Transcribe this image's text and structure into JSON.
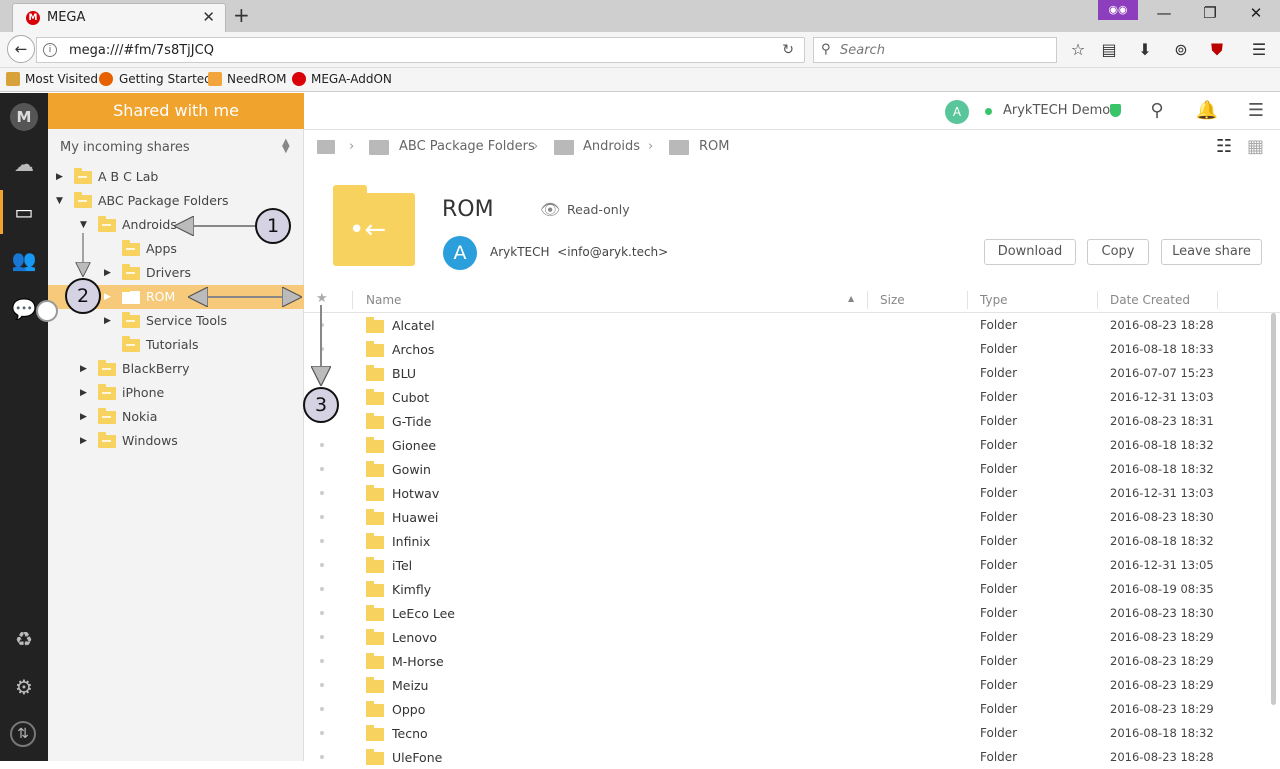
{
  "browser": {
    "tab_title": "MEGA",
    "favicon": "M",
    "url": "mega:///#fm/7s8TjJCQ",
    "search_placeholder": "Search",
    "bookmarks": [
      "Most Visited",
      "Getting Started",
      "NeedROM",
      "MEGA-AddON"
    ],
    "private_icon": "mask-icon"
  },
  "rail": {
    "items": [
      "mega-logo-icon",
      "cloud-drive-icon",
      "shared-folder-icon",
      "contacts-icon",
      "chat-icon",
      "rubbish-bin-icon",
      "settings-icon",
      "transfers-icon"
    ],
    "logo": "M"
  },
  "tree": {
    "header": "Shared with me",
    "incoming_label": "My incoming shares",
    "nodes": [
      {
        "label": "A B C Lab"
      },
      {
        "label": "ABC Package Folders"
      },
      {
        "label": "Androids"
      },
      {
        "label": "Apps"
      },
      {
        "label": "Drivers"
      },
      {
        "label": "ROM"
      },
      {
        "label": "Service Tools"
      },
      {
        "label": "Tutorials"
      },
      {
        "label": "BlackBerry"
      },
      {
        "label": "iPhone"
      },
      {
        "label": "Nokia"
      },
      {
        "label": "Windows"
      }
    ]
  },
  "topbar": {
    "avatar_letter": "A",
    "user_name": "ArykTECH Demo",
    "status_color": "#3ac46a"
  },
  "breadcrumb": [
    "ABC Package Folders",
    "Androids",
    "ROM"
  ],
  "folder_header": {
    "title": "ROM",
    "access": "Read-only",
    "owner_initial": "A",
    "owner_name": "ArykTECH",
    "owner_email": "<info@aryk.tech>",
    "buttons": {
      "download": "Download",
      "copy": "Copy",
      "leave": "Leave share"
    }
  },
  "columns": {
    "name": "Name",
    "size": "Size",
    "type": "Type",
    "date": "Date Created"
  },
  "rows": [
    {
      "name": "Alcatel",
      "type": "Folder",
      "date": "2016-08-23 18:28"
    },
    {
      "name": "Archos",
      "type": "Folder",
      "date": "2016-08-18 18:33"
    },
    {
      "name": "BLU",
      "type": "Folder",
      "date": "2016-07-07 15:23"
    },
    {
      "name": "Cubot",
      "type": "Folder",
      "date": "2016-12-31 13:03"
    },
    {
      "name": "G-Tide",
      "type": "Folder",
      "date": "2016-08-23 18:31"
    },
    {
      "name": "Gionee",
      "type": "Folder",
      "date": "2016-08-18 18:32"
    },
    {
      "name": "Gowin",
      "type": "Folder",
      "date": "2016-08-18 18:32"
    },
    {
      "name": "Hotwav",
      "type": "Folder",
      "date": "2016-12-31 13:03"
    },
    {
      "name": "Huawei",
      "type": "Folder",
      "date": "2016-08-23 18:30"
    },
    {
      "name": "Infinix",
      "type": "Folder",
      "date": "2016-08-18 18:32"
    },
    {
      "name": "iTel",
      "type": "Folder",
      "date": "2016-12-31 13:05"
    },
    {
      "name": "Kimfly",
      "type": "Folder",
      "date": "2016-08-19 08:35"
    },
    {
      "name": "LeEco Lee",
      "type": "Folder",
      "date": "2016-08-23 18:30"
    },
    {
      "name": "Lenovo",
      "type": "Folder",
      "date": "2016-08-23 18:29"
    },
    {
      "name": "M-Horse",
      "type": "Folder",
      "date": "2016-08-23 18:29"
    },
    {
      "name": "Meizu",
      "type": "Folder",
      "date": "2016-08-23 18:29"
    },
    {
      "name": "Oppo",
      "type": "Folder",
      "date": "2016-08-23 18:29"
    },
    {
      "name": "Tecno",
      "type": "Folder",
      "date": "2016-08-18 18:32"
    },
    {
      "name": "UleFone",
      "type": "Folder",
      "date": "2016-08-23 18:28"
    }
  ],
  "annotations": [
    "1",
    "2",
    "3"
  ]
}
